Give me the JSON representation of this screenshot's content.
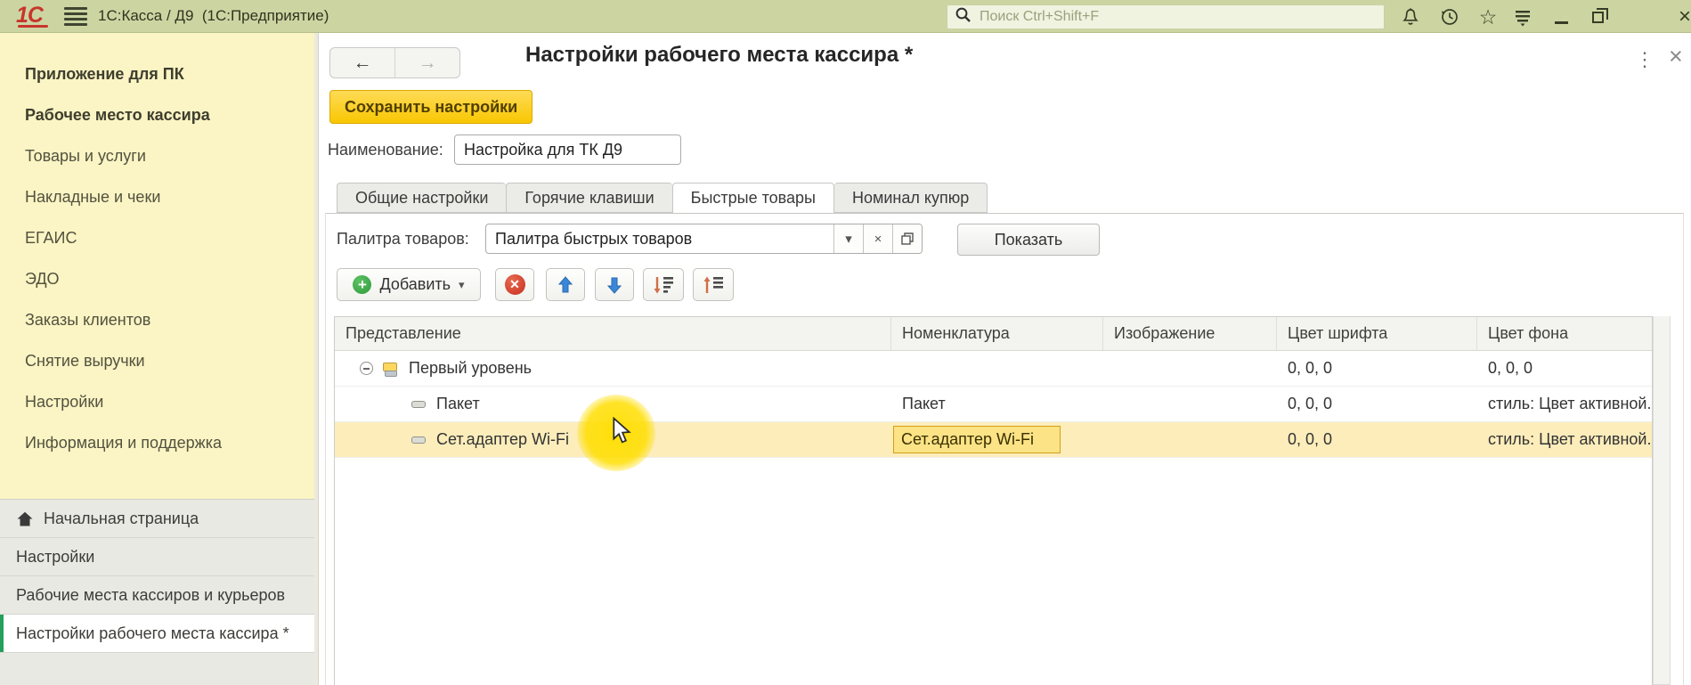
{
  "colors": {
    "topbar_bg": "#ccd5a2",
    "sidebar_bg": "#fbf4c4",
    "accent_green": "#23a05a",
    "save_button_bg": "#fccf1b",
    "selection_bg": "#fcedbb",
    "edit_cell_bg": "#fbe386",
    "edit_cell_border": "#d4a017",
    "logo_red": "#c8362b"
  },
  "topbar": {
    "logo": "1С",
    "title": "1С:Касса / Д9  (1С:Предприятие)",
    "search_placeholder": "Поиск Ctrl+Shift+F",
    "icons": [
      "bell-icon",
      "history-icon",
      "favorites-star-icon",
      "full-functions-icon",
      "minimize-icon",
      "restore-icon",
      "close-icon"
    ]
  },
  "sidebar": {
    "items": [
      {
        "label": "Приложение для ПК",
        "bold": true
      },
      {
        "label": "Рабочее место кассира",
        "bold": true
      },
      {
        "label": "Товары и услуги",
        "bold": false
      },
      {
        "label": "Накладные и чеки",
        "bold": false
      },
      {
        "label": "ЕГАИС",
        "bold": false
      },
      {
        "label": "ЭДО",
        "bold": false
      },
      {
        "label": "Заказы клиентов",
        "bold": false
      },
      {
        "label": "Снятие выручки",
        "bold": false
      },
      {
        "label": "Настройки",
        "bold": false
      },
      {
        "label": "Информация и поддержка",
        "bold": false
      }
    ]
  },
  "dock": {
    "items": [
      {
        "label": "Начальная страница",
        "icon": "home",
        "active": false
      },
      {
        "label": "Настройки",
        "active": false
      },
      {
        "label": "Рабочие места кассиров и курьеров",
        "active": false
      },
      {
        "label": "Настройки рабочего места кассира *",
        "active": true
      }
    ]
  },
  "content": {
    "title": "Настройки рабочего места кассира *",
    "save_button": "Сохранить настройки",
    "name_label": "Наименование:",
    "name_value": "Настройка для ТК Д9",
    "tabs": [
      {
        "label": "Общие настройки",
        "active": false
      },
      {
        "label": "Горячие клавиши",
        "active": false
      },
      {
        "label": "Быстрые товары",
        "active": true
      },
      {
        "label": "Номинал купюр",
        "active": false
      }
    ],
    "palette_label": "Палитра товаров:",
    "palette_value": "Палитра быстрых товаров",
    "show_button": "Показать",
    "toolbar": {
      "add_label": "Добавить",
      "icons": [
        "add-plus-icon",
        "delete-icon",
        "move-up-icon",
        "move-down-icon",
        "sort-descending-icon",
        "sort-ascending-icon"
      ]
    },
    "table": {
      "columns": [
        "Представление",
        "Номенклатура",
        "Изображение",
        "Цвет шрифта",
        "Цвет фона"
      ],
      "rows": [
        {
          "name": "Первый уровень",
          "type": "group",
          "nomenclature": "",
          "image": "",
          "font_color": "0, 0, 0",
          "bg_color": "0, 0, 0",
          "selected": false,
          "editing": false
        },
        {
          "name": "Пакет",
          "type": "item",
          "nomenclature": "Пакет",
          "image": "",
          "font_color": "0, 0, 0",
          "bg_color": "стиль: Цвет активной...",
          "selected": false,
          "editing": false
        },
        {
          "name": "Сет.адаптер Wi-Fi",
          "type": "item",
          "nomenclature": "Сет.адаптер Wi-Fi",
          "image": "",
          "font_color": "0, 0, 0",
          "bg_color": "стиль: Цвет активной...",
          "selected": true,
          "editing": true
        }
      ]
    }
  }
}
